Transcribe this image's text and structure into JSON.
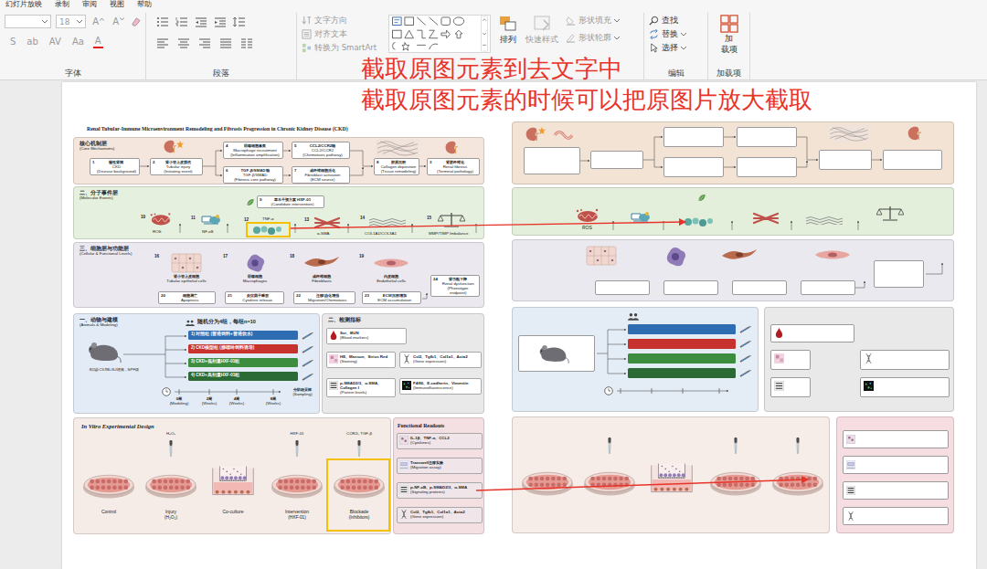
{
  "menu": [
    {
      "label": "幻灯片放映"
    },
    {
      "label": "录制"
    },
    {
      "label": "审阅"
    },
    {
      "label": "视图"
    },
    {
      "label": "帮助"
    }
  ],
  "ribbon": {
    "font": {
      "disabled": true,
      "size": "18",
      "row1": [
        "A",
        "A"
      ],
      "row2": [
        "S",
        "ab",
        "AV",
        "Aa",
        "A"
      ],
      "label": "字体"
    },
    "paragraph": {
      "label": "段落",
      "tools": [
        {
          "label": "文字方向",
          "disabled": true
        },
        {
          "label": "对齐文本",
          "disabled": true
        },
        {
          "label": "转换为 SmartArt",
          "disabled": true
        }
      ]
    },
    "drawing": {
      "arrange": {
        "label": "排列",
        "disabled": false
      },
      "quick_styles": {
        "label": "快速样式",
        "disabled": true
      },
      "shape_format": [
        {
          "label": "形状填充",
          "disabled": true
        },
        {
          "label": "形状轮廓",
          "disabled": true
        }
      ]
    },
    "editing": {
      "label": "编辑",
      "items": [
        {
          "label": "查找",
          "disabled": false
        },
        {
          "label": "替换",
          "disabled": false
        },
        {
          "label": "选择",
          "disabled": false
        }
      ]
    },
    "addins": {
      "label": "加载项",
      "button_top": "加",
      "button_bottom": "载项"
    }
  },
  "annotations": [
    "截取原图元素到去文字中",
    "截取原图元素的时候可以把原图片放大截取"
  ],
  "figure": {
    "title": "Renal Tubular-Immune Microenvironment Remodeling and Fibrosis Progression in Chronic Kidney Disease (CKD)",
    "core": {
      "label_cn": "核心机制层",
      "label_en": "(Core Mechanisms)",
      "boxes": [
        {
          "num": "1",
          "cn": "慢性肾病",
          "en": "CKD",
          "note": "(Disease background)"
        },
        {
          "num": "2",
          "cn": "肾小管上皮损伤",
          "en": "Tubular injury",
          "note": "(Initiating event)"
        },
        {
          "num": "4",
          "cn": "巨噬细胞募集",
          "en": "Macrophage recruitment",
          "note": "(Inflammation amplification)"
        },
        {
          "num": "5",
          "cn": "CCL2/CCR2轴",
          "en": "CCL2/CCR2",
          "note": "(Chemotaxis pathway)"
        },
        {
          "num": "6",
          "cn": "TGF-β/SMAD轴",
          "en": "TGF-β/SMAD",
          "note": "(Fibrosis core pathway)"
        },
        {
          "num": "7",
          "cn": "成纤维细胞活化",
          "en": "Fibroblast activation",
          "note": "(ECM source)"
        },
        {
          "num": "8",
          "cn": "胶原沉积",
          "en": "Collagen deposition",
          "note": "(Tissue remodeling)"
        },
        {
          "num": "3",
          "cn": "肾脏纤维化",
          "en": "Renal fibrosis",
          "note": "(Terminal pathology)"
        }
      ]
    },
    "molecular": {
      "label_cn": "二、分子事件层",
      "label_en": "(Molecular Events)",
      "intervention": {
        "num": "9",
        "cn": "草本干预方案 HXF-01",
        "note": "(Candidate intervention)"
      },
      "items": [
        {
          "num": "10",
          "label": "ROS",
          "highlighted": false
        },
        {
          "num": "11",
          "label": "NF-κB",
          "highlighted": false
        },
        {
          "num": "12",
          "label": "TNF-α",
          "highlighted": true
        },
        {
          "num": "13",
          "label": "α-SMA",
          "highlighted": false
        },
        {
          "num": "14",
          "label": "COL1A1/COL3A1",
          "highlighted": false
        },
        {
          "num": "15",
          "label": "MMP/TIMP Imbalance",
          "highlighted": false
        }
      ]
    },
    "cellular": {
      "label_cn": "三、细胞层与功能层",
      "label_en": "(Cellular & Functional Levels)",
      "cells": [
        {
          "num": "16",
          "cn": "肾小管上皮细胞",
          "en": "Tubular epithelial cells"
        },
        {
          "num": "17",
          "cn": "巨噬细胞",
          "en": "Macrophages"
        },
        {
          "num": "18",
          "cn": "成纤维细胞",
          "en": "Fibroblasts"
        },
        {
          "num": "19",
          "cn": "内皮细胞",
          "en": "Endothelial cells"
        }
      ],
      "functions": [
        {
          "num": "20",
          "cn": "细胞凋亡",
          "en": "Apoptosis"
        },
        {
          "num": "21",
          "cn": "炎症因子释放",
          "en": "Cytokine release"
        },
        {
          "num": "22",
          "cn": "迁移/趋化增强",
          "en": "Migration/Chemotaxis"
        },
        {
          "num": "23",
          "cn": "ECM沉积增加",
          "en": "ECM accumulation"
        }
      ],
      "endpoint": {
        "num": "24",
        "cn": "肾功能下降",
        "en": "Renal dysfunction",
        "note": "(Phenotypic endpoint)"
      }
    },
    "animals": {
      "label_cn": "一、动物与建模",
      "label_en": "(Animals & Modeling)",
      "grouping": "随机分为4组，每组n=10",
      "groups": [
        {
          "label": "1) 对照组 (普通饲料+普通饮水)",
          "color": "#2f6db3"
        },
        {
          "label": "2) CKD模型组 (腺嘌呤饲料诱导)",
          "color": "#c8322e"
        },
        {
          "label": "3) CKD+低剂量HXF-01组",
          "color": "#3d8d3f"
        },
        {
          "label": "4) CKD+高剂量HXF-01组",
          "color": "#2c6a35"
        }
      ],
      "mouse": "8周龄C57BL/6J雄鼠，SPF级",
      "timeline": [
        {
          "week": "0周",
          "note": "(Modeling)"
        },
        {
          "week": "2周",
          "note": "(Weeks)"
        },
        {
          "week": "4周",
          "note": "(Weeks)"
        },
        {
          "week": "8周",
          "note": "(Weeks)"
        }
      ],
      "sampling": {
        "cn": "分阶段采样",
        "en": "(Sampling)"
      }
    },
    "detection": {
      "label": "二、检测指标",
      "items": [
        {
          "text": "Scr、BUN",
          "note": "(Blood markers)"
        },
        {
          "text": "HE、Masson、Sirius Red",
          "note": "(Staining)"
        },
        {
          "text": "Ccl2、Tgfb1、Col1a1、Acta2",
          "note": "(Gene expression)"
        },
        {
          "text": "p-SMAD2/3、α-SMA、Collagen I",
          "note": "(Protein levels)"
        },
        {
          "text": "F4/80、E-cadherin、Vimentin",
          "note": "(Immunofluorescence)"
        }
      ]
    },
    "in_vitro": {
      "title": "In Vitro Experimental Design",
      "conditions": [
        {
          "name": "Control",
          "kind": "dish",
          "highlighted": false
        },
        {
          "name": "Injury",
          "note": "(H₂O₂)",
          "reagent": "H₂O₂",
          "kind": "dish",
          "highlighted": false
        },
        {
          "name": "Co-culture",
          "kind": "transwell",
          "highlighted": false
        },
        {
          "name": "Intervention",
          "note": "(HXF-01)",
          "reagent": "HXF-01",
          "kind": "dish",
          "highlighted": false
        },
        {
          "name": "Blockade",
          "note": "(Inhibitors)",
          "reagent": "CCR2i, TGF-β",
          "kind": "dish",
          "highlighted": true
        }
      ]
    },
    "readouts": {
      "title": "Functional Readouts",
      "items": [
        {
          "text": "IL-1β、TNF-α、CCL2",
          "note": "(Cytokines)"
        },
        {
          "text": "Transwell迁移实验",
          "note": "(Migration assay)"
        },
        {
          "text": "p-NF-κB、p-SMAD2/3、α-SMA",
          "note": "(Signaling proteins)"
        },
        {
          "text": "Ccl2、Tgfb1、Col1a1、Acta2",
          "note": "(Gene expression)"
        }
      ]
    }
  },
  "template": {
    "ros_label": "ROS"
  }
}
